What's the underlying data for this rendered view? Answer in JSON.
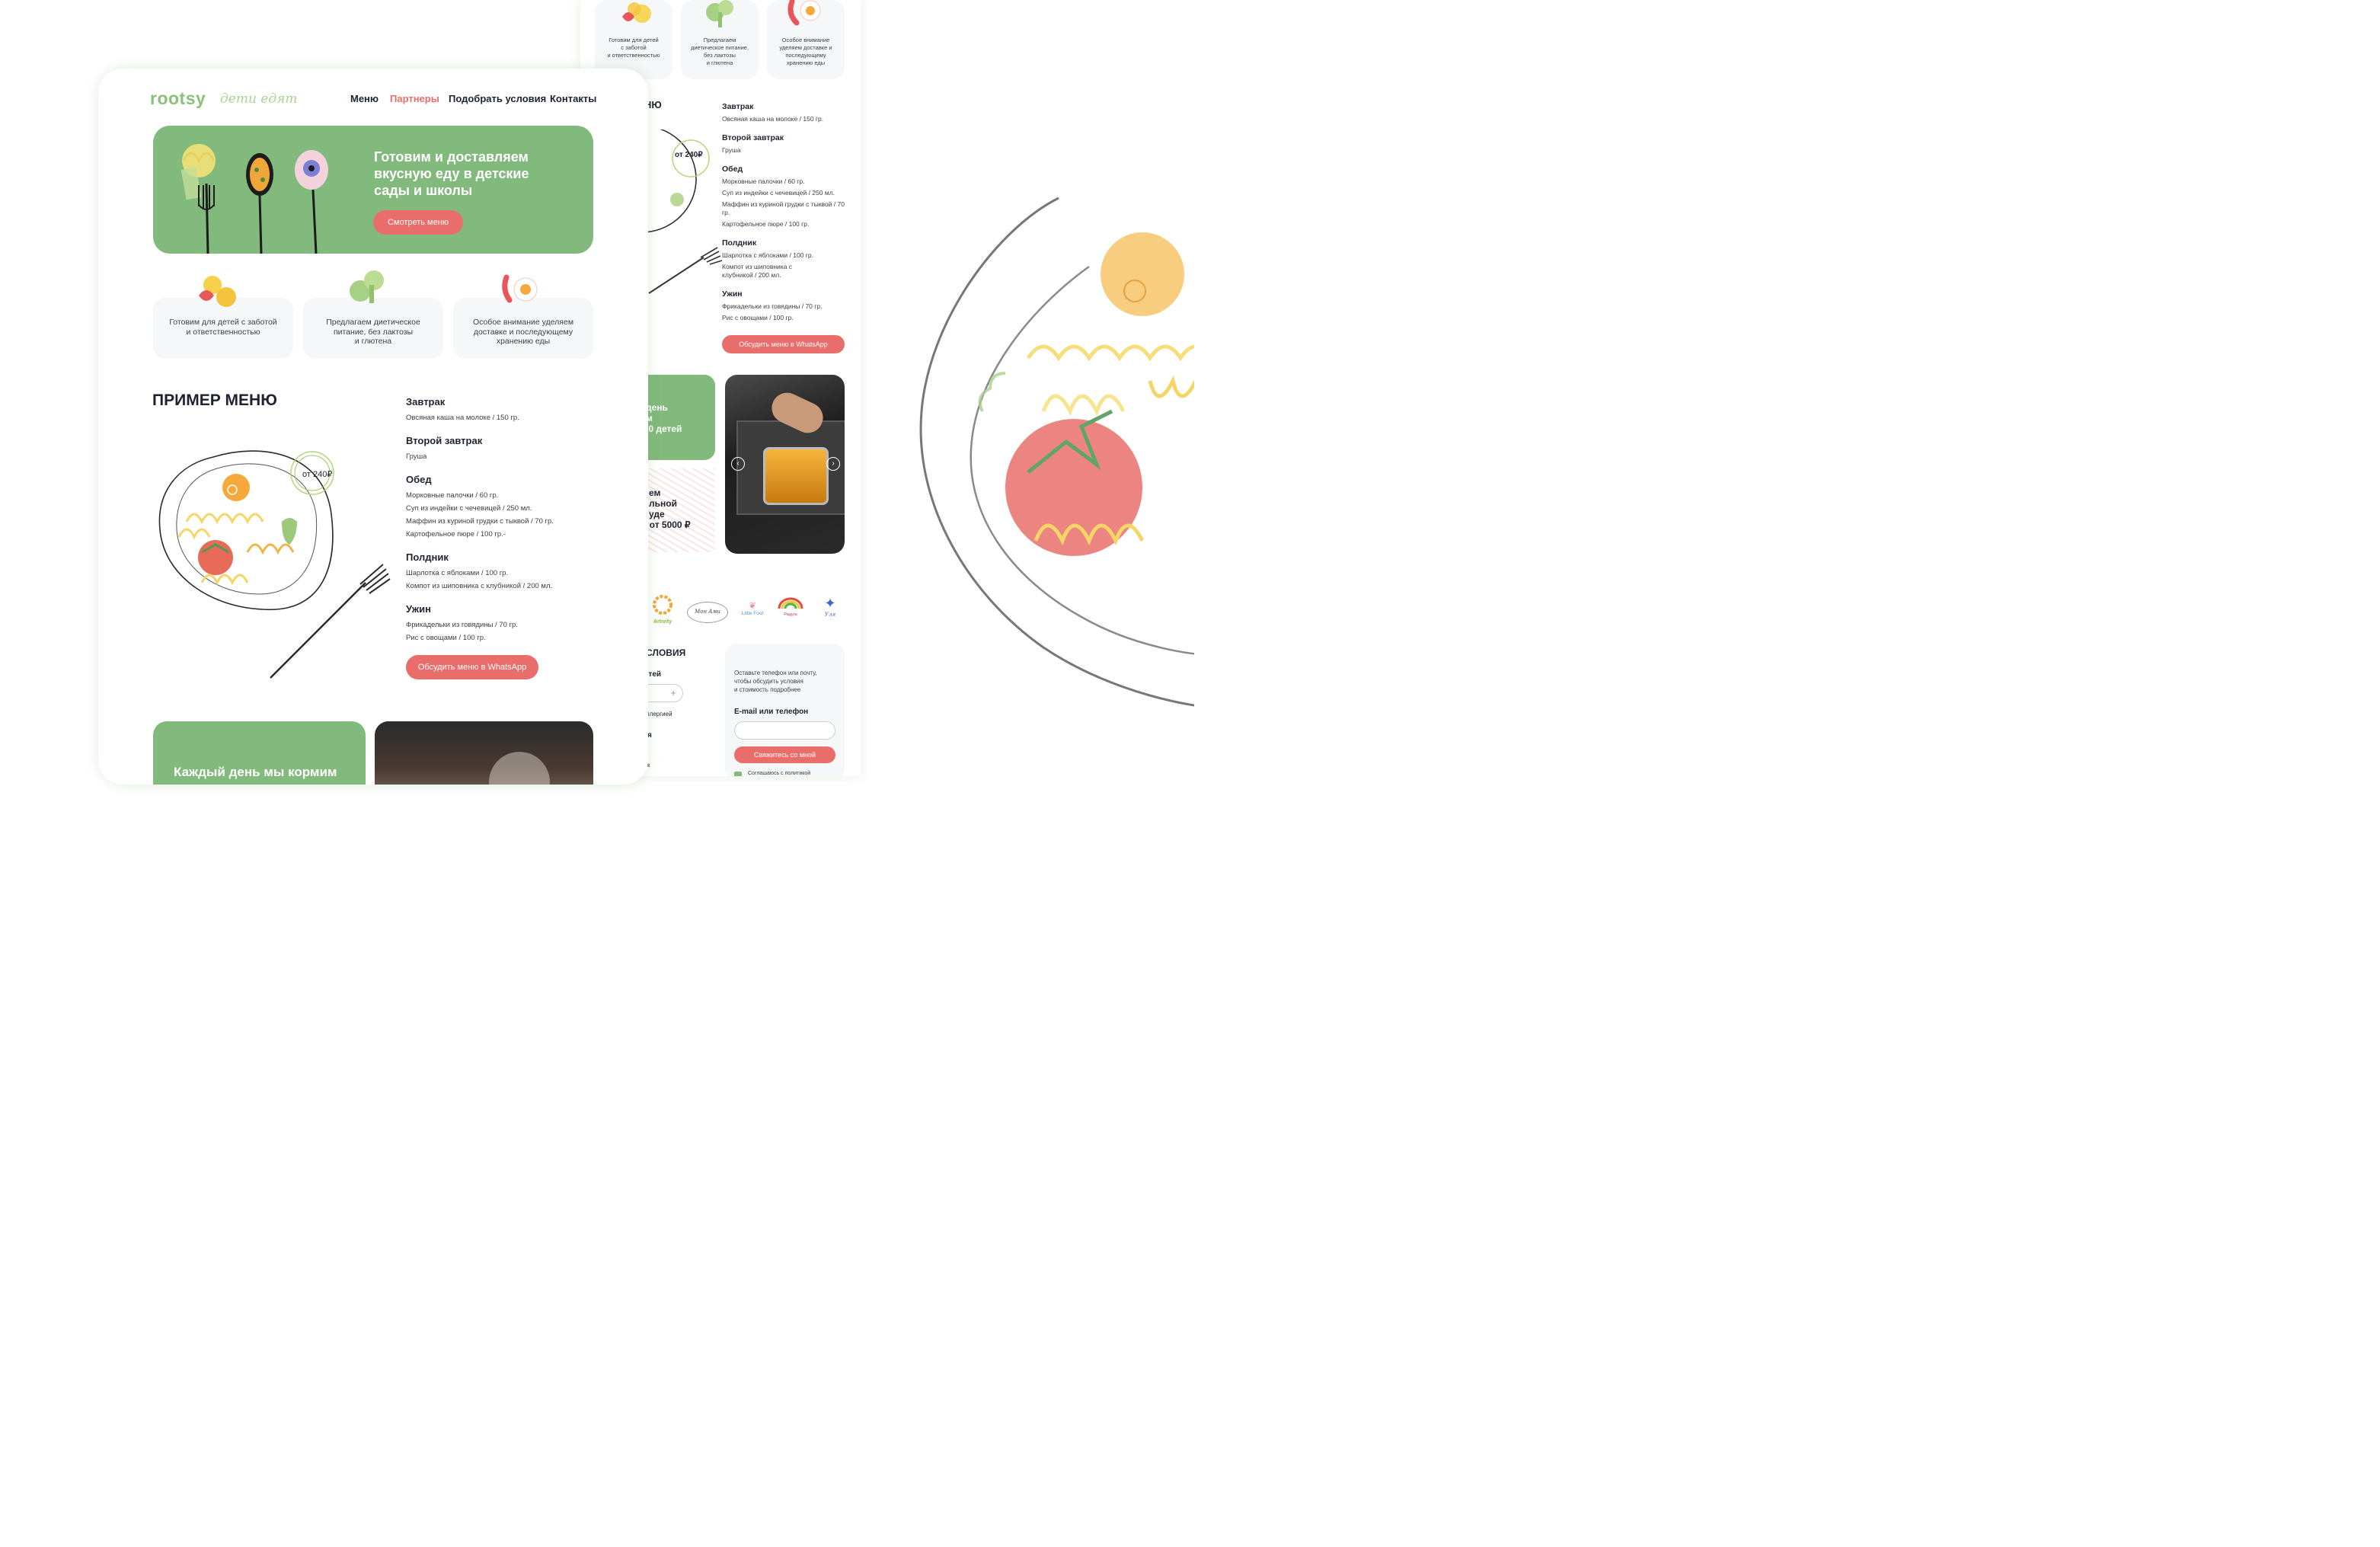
{
  "colors": {
    "accent_green": "#82b97c",
    "accent_red": "#e96d6a",
    "logo_green": "#8cc07a",
    "card_bg": "#f6f7f8",
    "text": "#1d2330"
  },
  "logo": {
    "brand": "rootsy",
    "tagline": "дети едят"
  },
  "nav": {
    "items": [
      {
        "label": "Меню",
        "active": false
      },
      {
        "label": "Партнеры",
        "active": true
      },
      {
        "label": "Подобрать условия",
        "active": false
      },
      {
        "label": "Контакты",
        "active": false
      }
    ]
  },
  "hero": {
    "title": "Готовим и доставляем вкусную еду в детские сады и школы",
    "button": "Смотреть меню"
  },
  "features": [
    {
      "text": "Готовим для детей с заботой\nи ответственностью",
      "icon": "fruit-icon"
    },
    {
      "text": "Предлагаем диетическое\nпитание, без лактозы\nи глютена",
      "icon": "broccoli-icon"
    },
    {
      "text": "Особое внимание уделяем\nдоставке и последующему\nхранению еды",
      "icon": "egg-sausage-icon"
    }
  ],
  "back_features": [
    {
      "text": "Готовим для детей\nс заботой\nи ответственностью"
    },
    {
      "text": "Предлагаем\nдиетическое питание,\nбез лактозы\nи глютена"
    },
    {
      "text": "Особое внимание\nуделяем доставке и\nпоследующему\nхранению еды"
    }
  ],
  "menu": {
    "title": "ПРИМЕР МЕНЮ",
    "price": "от 240₽",
    "sections": [
      {
        "name": "Завтрак",
        "items": [
          "Овсяная каша на молоке / 150 гр."
        ]
      },
      {
        "name": "Второй завтрак",
        "items": [
          "Груша"
        ]
      },
      {
        "name": "Обед",
        "items": [
          "Морковные палочки / 60 гр.",
          "Суп из индейки с чечевицей / 250 мл.",
          "Маффин из куриной грудки с тыквой / 70 гр.",
          "Картофельное пюре / 100 гр.-"
        ]
      },
      {
        "name": "Полдник",
        "items": [
          "Шарлотка с яблоками / 100 гр.",
          "Компот из шиповника с клубникой / 200 мл."
        ]
      },
      {
        "name": "Ужин",
        "items": [
          "Фрикадельки из говядины / 70 гр.",
          "Рис с овощами / 100 гр."
        ]
      }
    ],
    "button": "Обсудить меню в WhatsApp"
  },
  "back_menu": {
    "title_fragment": "НЮ",
    "price": "от 240₽",
    "sections": [
      {
        "name": "Завтрак",
        "items": [
          "Овсяная каша на молоке / 150 гр."
        ]
      },
      {
        "name": "Второй завтрак",
        "items": [
          "Груша"
        ]
      },
      {
        "name": "Обед",
        "items": [
          "Морковные палочки / 60 гр.",
          "Суп из индейки с чечевицей / 250 мл.",
          "Маффин из куриной грудки с тыквой / 70",
          "гр.",
          "Картофельное пюре / 100 гр."
        ]
      },
      {
        "name": "Полдник",
        "items": [
          "Шарлотка с яблоками / 100 гр.",
          "Компот из шиповника с",
          "клубникой / 200 мл."
        ]
      },
      {
        "name": "Ужин",
        "items": [
          "Фрикадельки из говядины / 70 гр.",
          "Рис с овощами / 100 гр."
        ]
      }
    ],
    "button": "Обсудить меню в WhatsApp"
  },
  "back_stats": {
    "lines": [
      "день",
      "м",
      "000 детей"
    ]
  },
  "back_promo": {
    "lines": [
      "ем",
      "льной",
      "уде",
      "о от 5000 ₽"
    ]
  },
  "partners": [
    "Artivity",
    "Мон Ами",
    "Little Foot",
    "Радуга",
    "Уля"
  ],
  "back_conditions": {
    "title_fragment": "ь УСЛОВИЯ",
    "children_label": "етей",
    "allergy_label": "ллергией",
    "field_fragment": "я",
    "small_fragment": "к",
    "plus": "+"
  },
  "contact_form": {
    "description": "Оставьте телефон или почту,\nчтобы обсудить условия\nи стоимость подробнее",
    "field_label": "E-mail или телефон",
    "button": "Свяжитесь со мной",
    "consent_fragment": "Соглашаюсь с политикой"
  },
  "front_bottom": {
    "stats_text": "Каждый день мы кормим"
  }
}
